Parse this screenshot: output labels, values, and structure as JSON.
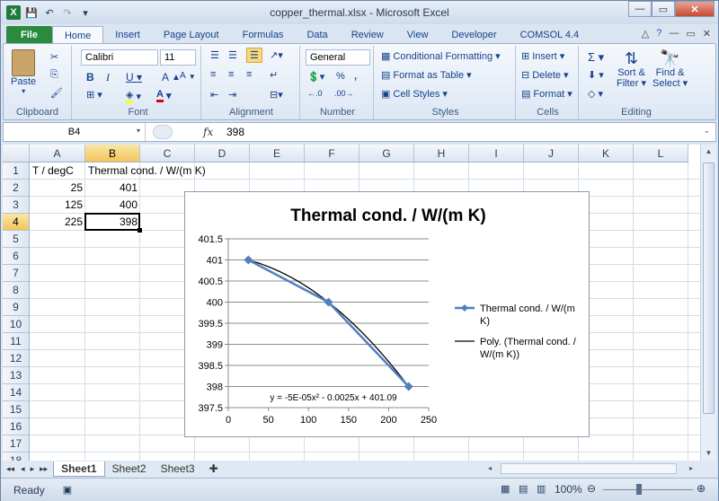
{
  "window": {
    "title": "copper_thermal.xlsx - Microsoft Excel"
  },
  "tabs": [
    "File",
    "Home",
    "Insert",
    "Page Layout",
    "Formulas",
    "Data",
    "Review",
    "View",
    "Developer",
    "COMSOL 4.4"
  ],
  "active_tab": "Home",
  "ribbon": {
    "clipboard": {
      "label": "Clipboard",
      "paste": "Paste"
    },
    "font": {
      "label": "Font",
      "name": "Calibri",
      "size": "11"
    },
    "alignment": {
      "label": "Alignment"
    },
    "number": {
      "label": "Number",
      "format": "General"
    },
    "styles": {
      "label": "Styles",
      "conditional": "Conditional Formatting",
      "table": "Format as Table",
      "cell": "Cell Styles"
    },
    "cells": {
      "label": "Cells",
      "insert": "Insert",
      "delete": "Delete",
      "format": "Format"
    },
    "editing": {
      "label": "Editing",
      "sort": "Sort &",
      "filter": "Filter",
      "find": "Find &",
      "select": "Select"
    }
  },
  "formula_bar": {
    "name_box": "B4",
    "fx": "fx",
    "value": "398"
  },
  "columns": [
    "A",
    "B",
    "C",
    "D",
    "E",
    "F",
    "G",
    "H",
    "I",
    "J",
    "K",
    "L"
  ],
  "rows": [
    "1",
    "2",
    "3",
    "4",
    "5",
    "6",
    "7",
    "8",
    "9",
    "10",
    "11",
    "12",
    "13",
    "14",
    "15",
    "16",
    "17",
    "18"
  ],
  "cells": {
    "A1": "T / degC",
    "B1": "Thermal cond. / W/(m K)",
    "A2": "25",
    "B2": "401",
    "A3": "125",
    "B3": "400",
    "A4": "225",
    "B4": "398"
  },
  "chart_data": {
    "type": "scatter",
    "title": "Thermal cond. / W/(m K)",
    "xlim": [
      0,
      250
    ],
    "ylim": [
      397.5,
      401.5
    ],
    "xticks": [
      "0",
      "50",
      "100",
      "150",
      "200",
      "250"
    ],
    "yticks": [
      "397.5",
      "398",
      "398.5",
      "399",
      "399.5",
      "400",
      "400.5",
      "401",
      "401.5"
    ],
    "grid": true,
    "legend_position": "right",
    "series": [
      {
        "name": "Thermal cond. / W/(m K)",
        "x": [
          25,
          125,
          225
        ],
        "y": [
          401,
          400,
          398
        ],
        "color": "#4f81bd"
      },
      {
        "name": "Poly. (Thermal cond. / W/(m K))",
        "color": "#000000",
        "trendline": {
          "a": -5e-05,
          "b": -0.0025,
          "c": 401.09
        }
      }
    ],
    "legend_lines": [
      [
        "Thermal cond. / W/(m",
        "K)"
      ],
      [
        "Poly. (Thermal cond. /",
        "W/(m K))"
      ]
    ],
    "equation": "y = -5E-05x² - 0.0025x + 401.09"
  },
  "sheets": [
    "Sheet1",
    "Sheet2",
    "Sheet3"
  ],
  "active_sheet": "Sheet1",
  "status": {
    "ready": "Ready",
    "zoom": "100%"
  }
}
